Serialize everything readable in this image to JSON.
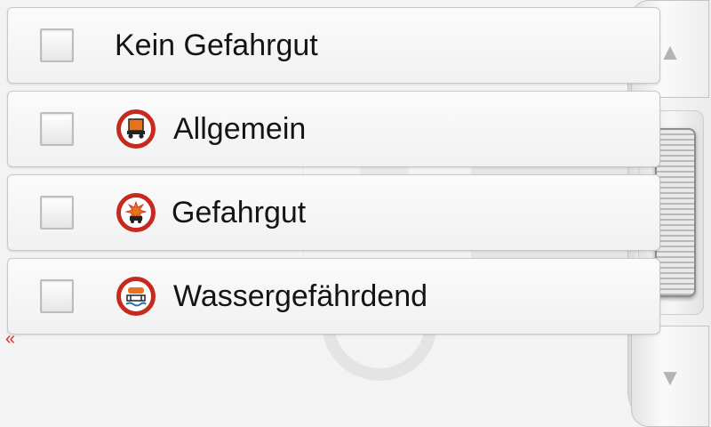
{
  "options": [
    {
      "label": "Kein Gefahrgut",
      "checked": false,
      "icon": null
    },
    {
      "label": "Allgemein",
      "checked": false,
      "icon": "hazmat-general-icon"
    },
    {
      "label": "Gefahrgut",
      "checked": false,
      "icon": "hazmat-explosive-icon"
    },
    {
      "label": "Wassergefährdend",
      "checked": false,
      "icon": "hazmat-water-polluting-icon"
    }
  ],
  "scroll": {
    "up_glyph": "▲",
    "down_glyph": "▼"
  },
  "back_glyph": "«",
  "colors": {
    "sign_red": "#c62a1e",
    "sign_orange": "#e8731c"
  }
}
